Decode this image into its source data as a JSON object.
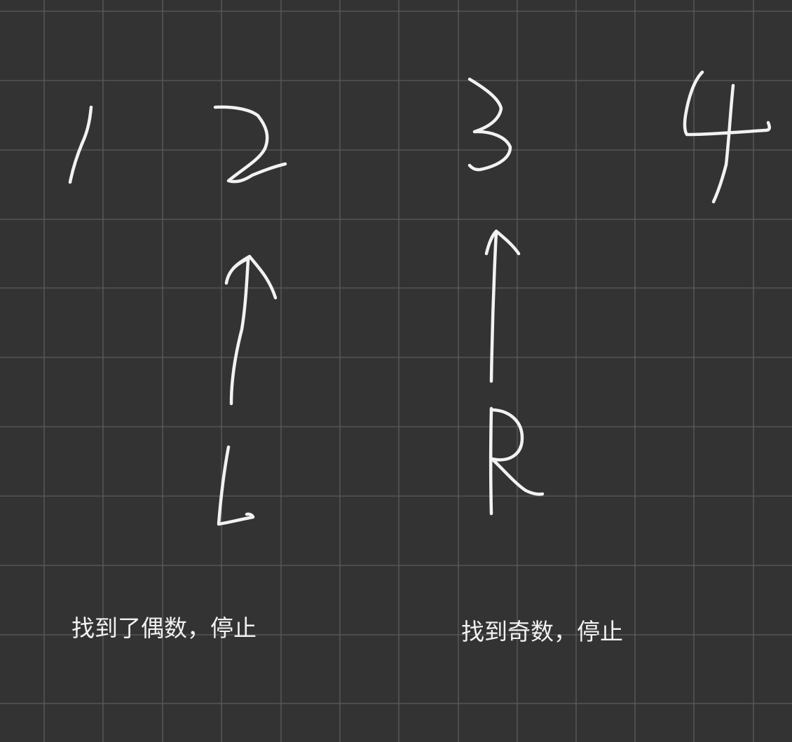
{
  "background_color": "#333333",
  "grid_color": "#5c5c5c",
  "ink_color": "#f2f2f2",
  "digits": [
    "1",
    "2",
    "3",
    "4"
  ],
  "pointers": {
    "left": "L",
    "right": "R"
  },
  "notes": {
    "left": "找到了偶数，停止",
    "right": "找到奇数，停止"
  }
}
